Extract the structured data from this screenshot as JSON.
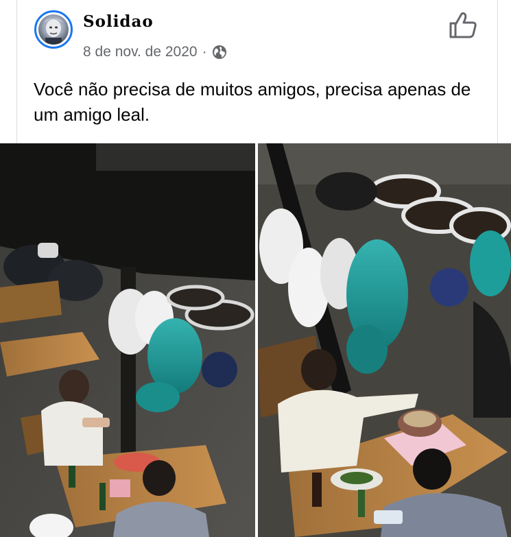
{
  "post": {
    "author": "Solidao",
    "date": "8 de nov. de 2020",
    "separator": "·",
    "privacy_icon": "globe-icon",
    "action_icon": "thumbs-up-icon",
    "text": "Você não precisa de muitos amigos, precisa apenas de um amigo leal."
  },
  "colors": {
    "accent": "#1877f2",
    "text": "#050505",
    "secondary_text": "#65676b"
  }
}
